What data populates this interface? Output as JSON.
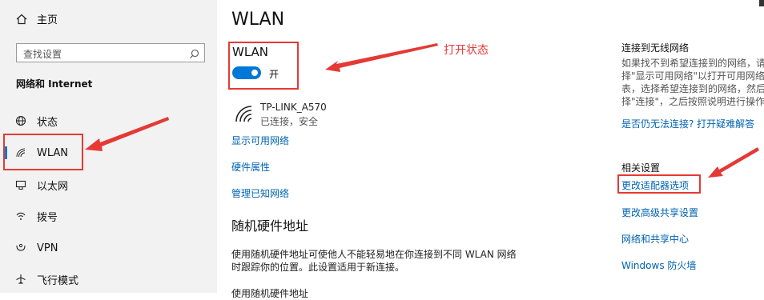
{
  "sidebar": {
    "home_label": "主页",
    "search_placeholder": "查找设置",
    "section_title": "网络和 Internet",
    "items": [
      {
        "label": "状态",
        "icon": "globe-icon"
      },
      {
        "label": "WLAN",
        "icon": "wifi-icon"
      },
      {
        "label": "以太网",
        "icon": "ethernet-icon"
      },
      {
        "label": "拨号",
        "icon": "dialup-icon"
      },
      {
        "label": "VPN",
        "icon": "vpn-icon"
      },
      {
        "label": "飞行模式",
        "icon": "airplane-icon"
      }
    ]
  },
  "main": {
    "page_title": "WLAN",
    "wlan_section_title": "WLAN",
    "toggle_state_label": "开",
    "toggle_on": true,
    "network": {
      "name": "TP-LINK_A570",
      "status": "已连接，安全"
    },
    "links": {
      "show_available": "显示可用网络",
      "hardware_properties": "硬件属性",
      "manage_known": "管理已知网络"
    },
    "random_mac": {
      "title": "随机硬件地址",
      "desc_line1": "使用随机硬件地址可使他人不能轻易地在你连接到不同 WLAN 网络",
      "desc_line2": "时跟踪你的位置。此设置适用于新连接。",
      "cutoff_text": "使用随机硬件地址"
    }
  },
  "annotations": {
    "open_state_label": "打开状态",
    "arrow_color": "#e53935"
  },
  "right_panel": {
    "connect_title": "连接到无线网络",
    "connect_desc": [
      "如果找不到希望连接到的网络，请",
      "择\"显示可用网络\"以打开可用网络",
      "表，选择希望连接到的网络，然后",
      "择\"连接\"，之后按照说明进行操作"
    ],
    "troubleshoot_link": "是否仍无法连接? 打开疑难解答",
    "related_title": "相关设置",
    "related_links": [
      "更改适配器选项",
      "更改高级共享设置",
      "网络和共享中心",
      "Windows 防火墙"
    ]
  },
  "colors": {
    "accent": "#0078d7",
    "link": "#0063b1",
    "sidebar_bg": "#f2f2f2",
    "annotation_red": "#e53935"
  }
}
